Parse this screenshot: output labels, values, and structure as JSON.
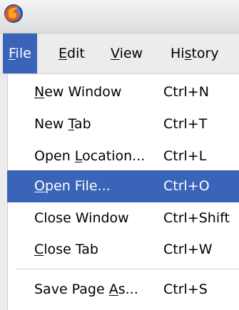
{
  "menubar": {
    "items": [
      {
        "pre": "",
        "ul": "F",
        "post": "ile"
      },
      {
        "pre": "",
        "ul": "E",
        "post": "dit"
      },
      {
        "pre": "",
        "ul": "V",
        "post": "iew"
      },
      {
        "pre": "Hi",
        "ul": "s",
        "post": "tory"
      }
    ]
  },
  "menu": {
    "items": [
      {
        "pre": "",
        "ul": "N",
        "post": "ew Window",
        "accel": "Ctrl+N"
      },
      {
        "pre": "New ",
        "ul": "T",
        "post": "ab",
        "accel": "Ctrl+T"
      },
      {
        "pre": "Open ",
        "ul": "L",
        "post": "ocation...",
        "accel": "Ctrl+L"
      },
      {
        "pre": "",
        "ul": "O",
        "post": "pen File...",
        "accel": "Ctrl+O"
      },
      {
        "pre": "Close Window",
        "ul": "",
        "post": "",
        "accel": "Ctrl+Shift"
      },
      {
        "pre": "",
        "ul": "C",
        "post": "lose Tab",
        "accel": "Ctrl+W"
      },
      {
        "pre": "Save Page ",
        "ul": "A",
        "post": "s...",
        "accel": "Ctrl+S"
      }
    ]
  },
  "colors": {
    "highlight": "#3a64b7",
    "menubar_bg": "#ececec"
  },
  "icons": {
    "app_logo": "firefox-logo-icon"
  }
}
